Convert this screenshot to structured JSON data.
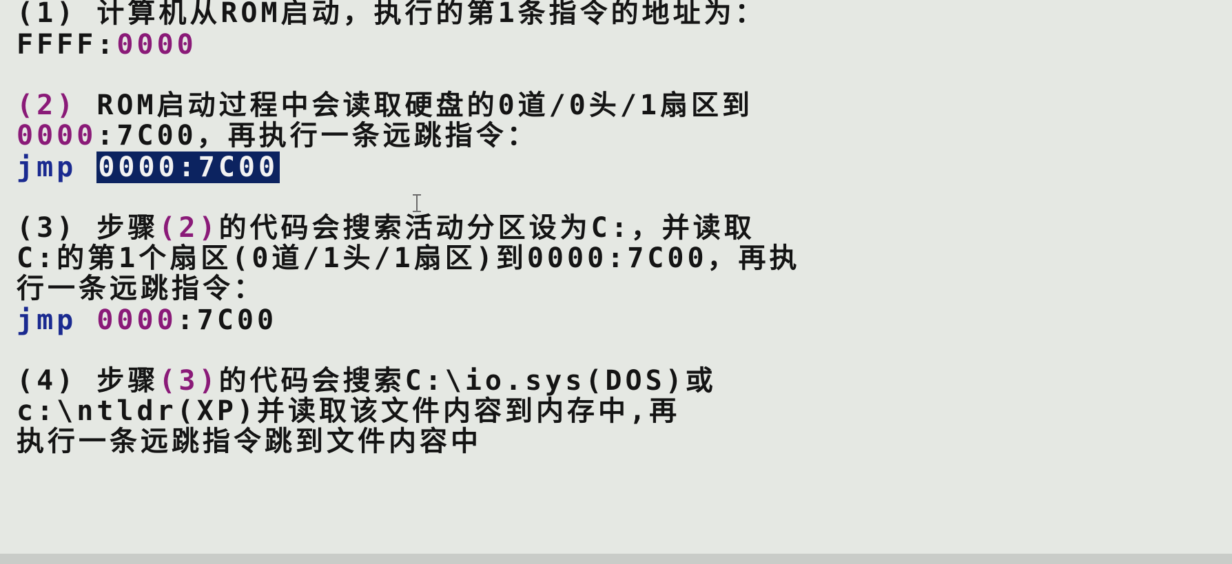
{
  "step1": {
    "line1_label": "(1)",
    "line1_text": " 计算机从ROM启动，执行的第1条指令的地址为：",
    "line2_seg": "FFFF:",
    "line2_addr": "0000"
  },
  "step2": {
    "line1_num": "(2)",
    "line1_text": " ROM启动过程中会读取硬盘的0道/0头/1扇区到",
    "line2_addr": "0000",
    "line2_text": ":7C00，再执行一条远跳指令：",
    "jmp_kw": "jmp",
    "jmp_target": "0000:7C00"
  },
  "step3": {
    "line1_num": "(3)",
    "line1_text": " 步骤",
    "line1_ref": "(2)",
    "line1_rest": "的代码会搜索活动分区设为C:，并读取",
    "line2_text": "C:的第1个扇区(0道/1头/1扇区)到0000:7C00，再执",
    "line3_text": "行一条远跳指令：",
    "jmp_kw": "jmp",
    "jmp_addr": "0000",
    "jmp_rest": ":7C00"
  },
  "step4": {
    "line1_num": "(4)",
    "line1_text": " 步骤",
    "line1_ref": "(3)",
    "line1_rest": "的代码会搜索C:\\io.sys(DOS)或",
    "line2_text": "c:\\ntldr(XP)并读取该文件内容到内存中,再",
    "line3_text": "执行一条远跳指令跳到文件内容中"
  },
  "colors": {
    "background": "#e5e8e3",
    "text": "#141414",
    "address": "#8a1a78",
    "keyword": "#1a2a90",
    "selection": "#0c2360"
  }
}
